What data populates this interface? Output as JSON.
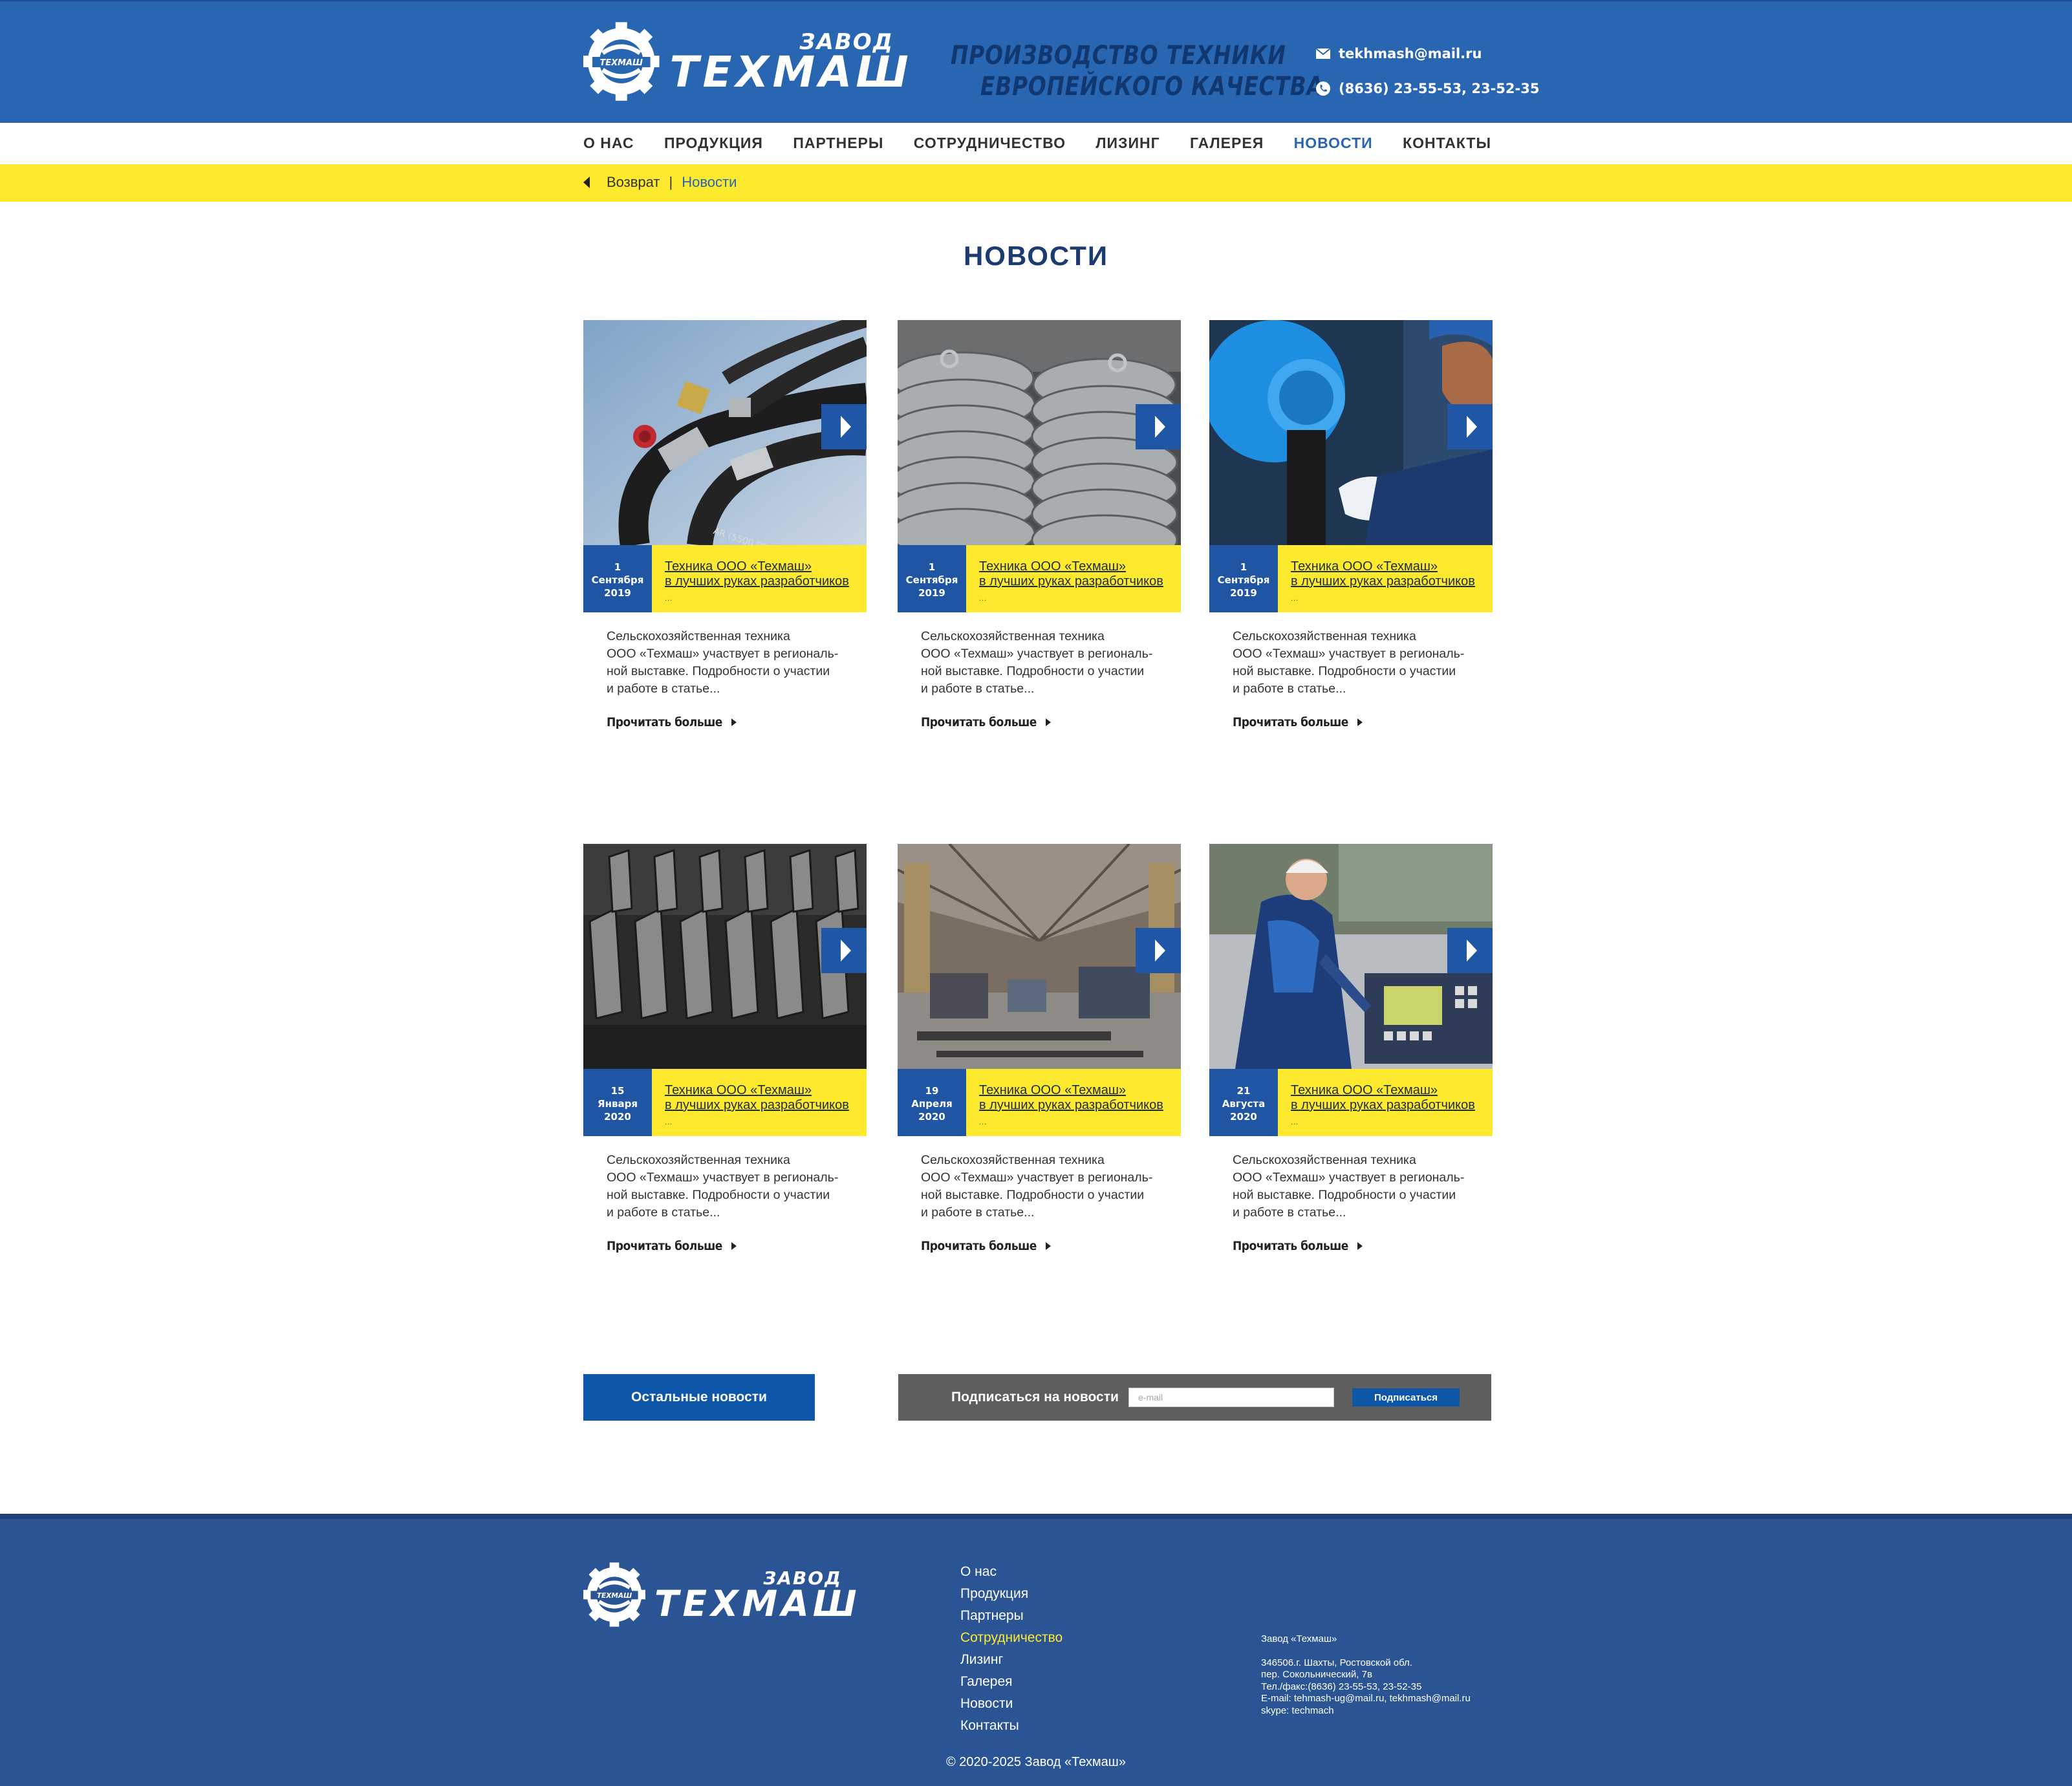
{
  "brand": {
    "small": "ЗАВОД",
    "big": "ТЕХМАШ",
    "gear_text": "ТЕХМАШ"
  },
  "header": {
    "tagline_line1": "ПРОИЗВОДСТВО  ТЕХНИКИ",
    "tagline_line2": "ЕВРОПЕЙСКОГО КАЧЕСТВА",
    "email": "tekhmash@mail.ru",
    "phone": "(8636) 23-55-53, 23-52-35",
    "email_icon": "envelope-icon",
    "phone_icon": "phone-icon"
  },
  "nav": {
    "items": [
      "О НАС",
      "ПРОДУКЦИЯ",
      "ПАРТНЕРЫ",
      "СОТРУДНИЧЕСТВО",
      "ЛИЗИНГ",
      "ГАЛЕРЕЯ",
      "НОВОСТИ",
      "КОНТАКТЫ"
    ],
    "active": "НОВОСТИ"
  },
  "breadcrumb": {
    "back": "Возврат",
    "separator": "|",
    "current": "Новости"
  },
  "page_title": "НОВОСТИ",
  "cards": [
    {
      "day": "1",
      "month": "Сентября",
      "year": "2019",
      "title1": "Техника ООО «Техмаш»",
      "title2": "в лучших руках разработчиков",
      "dots": "...",
      "excerpt": [
        "Сельскохозяйственная техника",
        "ООО «Техмаш» участвует в региональ-",
        "ной выставке. Подробности о участии",
        "и работе в статье..."
      ],
      "more": "Прочитать больше"
    },
    {
      "day": "1",
      "month": "Сентября",
      "year": "2019",
      "title1": "Техника ООО «Техмаш»",
      "title2": "в лучших руках разработчиков",
      "dots": "...",
      "excerpt": [
        "Сельскохозяйственная техника",
        "ООО «Техмаш» участвует в региональ-",
        "ной выставке. Подробности о участии",
        "и работе в статье..."
      ],
      "more": "Прочитать больше"
    },
    {
      "day": "1",
      "month": "Сентября",
      "year": "2019",
      "title1": "Техника ООО «Техмаш»",
      "title2": "в лучших руках разработчиков",
      "dots": "...",
      "excerpt": [
        "Сельскохозяйственная техника",
        "ООО «Техмаш» участвует в региональ-",
        "ной выставке. Подробности о участии",
        "и работе в статье..."
      ],
      "more": "Прочитать больше"
    },
    {
      "day": "15",
      "month": "Января",
      "year": "2020",
      "title1": "Техника ООО «Техмаш»",
      "title2": "в лучших руках разработчиков",
      "dots": "...",
      "excerpt": [
        "Сельскохозяйственная техника",
        "ООО «Техмаш» участвует в региональ-",
        "ной выставке. Подробности о участии",
        "и работе в статье..."
      ],
      "more": "Прочитать больше"
    },
    {
      "day": "19",
      "month": "Апреля",
      "year": "2020",
      "title1": "Техника ООО «Техмаш»",
      "title2": "в лучших руках разработчиков",
      "dots": "...",
      "excerpt": [
        "Сельскохозяйственная техника",
        "ООО «Техмаш» участвует в региональ-",
        "ной выставке. Подробности о участии",
        "и работе в статье..."
      ],
      "more": "Прочитать больше"
    },
    {
      "day": "21",
      "month": "Августа",
      "year": "2020",
      "title1": "Техника ООО «Техмаш»",
      "title2": "в лучших руках разработчиков",
      "dots": "...",
      "excerpt": [
        "Сельскохозяйственная техника",
        "ООО «Техмаш» участвует в региональ-",
        "ной выставке. Подробности о участии",
        "и работе в статье..."
      ],
      "more": "Прочитать больше"
    }
  ],
  "actions": {
    "more_news": "Остальные новости",
    "subscribe_label": "Подписаться на новости",
    "email_placeholder": "e-mail",
    "subscribe_button": "Подписаться"
  },
  "footer": {
    "menu": [
      "О нас",
      "Продукция",
      "Партнеры",
      "Сотрудничество",
      "Лизинг",
      "Галерея",
      "Новости",
      "Контакты"
    ],
    "menu_highlight": "Сотрудничество",
    "company": "Завод «Техмаш»",
    "address1": "346506.г. Шахты, Ростовской обл.",
    "address2": "пер. Сокольнический, 7в",
    "phone": "Тел./факс:(8636) 23-55-53, 23-52-35",
    "email": "E-mail: tehmash-ug@mail.ru, tekhmash@mail.ru",
    "skype": "skype: techmach",
    "copyright": "© 2020-2025 Завод «Техмаш»"
  },
  "colors": {
    "header_blue": "#2866b2",
    "footer_blue": "#2a5494",
    "accent_yellow": "#fde92e",
    "date_blue": "#2055a3",
    "title_navy": "#1c3b70"
  }
}
